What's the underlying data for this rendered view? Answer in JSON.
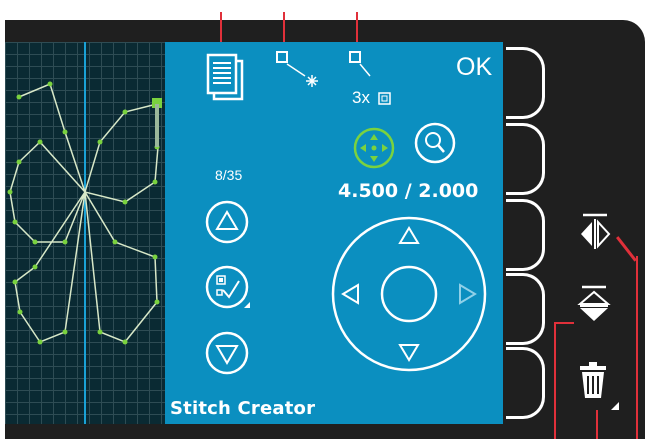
{
  "screen": {
    "title": "Stitch Creator",
    "ok_label": "OK",
    "stitch_counter": "8/35",
    "coordinates": "4.500 / 2.000",
    "repeat_label": "3x"
  },
  "icons": {
    "document": "document-stack-icon",
    "insert_point": "insert-point-icon",
    "triple_stitch": "triple-stitch-icon",
    "move_mode": "move-arrows-icon",
    "zoom": "zoom-icon",
    "step_up": "arrow-up-icon",
    "select_stitch": "select-stitch-icon",
    "step_down": "arrow-down-icon",
    "wheel": "navigation-wheel-icon",
    "mirror_side": "mirror-side-to-side-icon",
    "mirror_end": "mirror-end-to-end-icon",
    "delete": "trash-icon"
  },
  "colors": {
    "screen_blue": "#0b8fc0",
    "grid_bg": "#0a2a33",
    "stitch_green": "#7ad23f",
    "callout_red": "#e0303a",
    "panel_black": "#1f1f1f"
  }
}
